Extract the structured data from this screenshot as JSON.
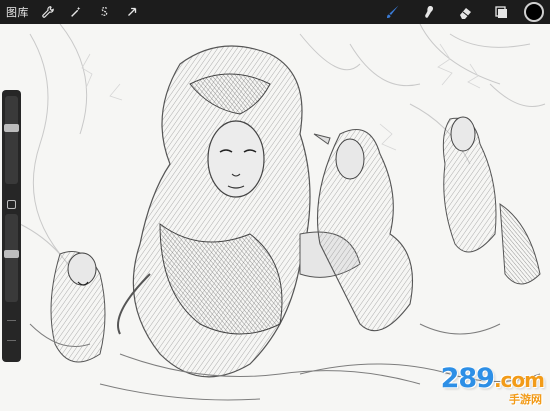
{
  "topbar": {
    "gallery_label": "图库",
    "left_tools": [
      {
        "icon": "wrench-icon"
      },
      {
        "icon": "magic-wand-icon"
      },
      {
        "icon": "selection-s-icon"
      },
      {
        "icon": "arrow-cursor-icon"
      }
    ],
    "right_tools": [
      {
        "icon": "brush-icon",
        "active": true
      },
      {
        "icon": "smudge-icon"
      },
      {
        "icon": "eraser-icon"
      },
      {
        "icon": "layers-icon"
      }
    ],
    "current_color": "#000000",
    "active_color": "#3a7bd5"
  },
  "canvas": {
    "artwork": "pencil-sketch-illustration"
  },
  "sidebar": {
    "brush_size_level": 0.65,
    "opacity_level": 0.55
  },
  "watermark": {
    "brand_digits": "289",
    "brand_suffix": ".com",
    "brand_cn": "手游网"
  }
}
